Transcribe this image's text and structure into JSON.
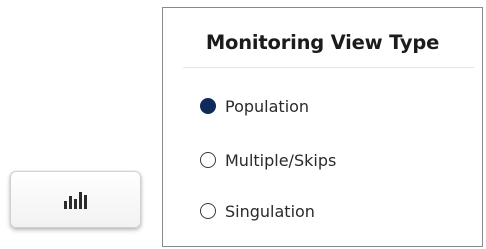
{
  "chart_button": {
    "icon": "bar-chart-icon"
  },
  "panel": {
    "title": "Monitoring View Type",
    "options": [
      {
        "label": "Population",
        "selected": true
      },
      {
        "label": "Multiple/Skips",
        "selected": false
      },
      {
        "label": "Singulation",
        "selected": false
      }
    ]
  },
  "colors": {
    "selected_radio": "#0e2a5a",
    "panel_border": "#8a8a8a"
  }
}
